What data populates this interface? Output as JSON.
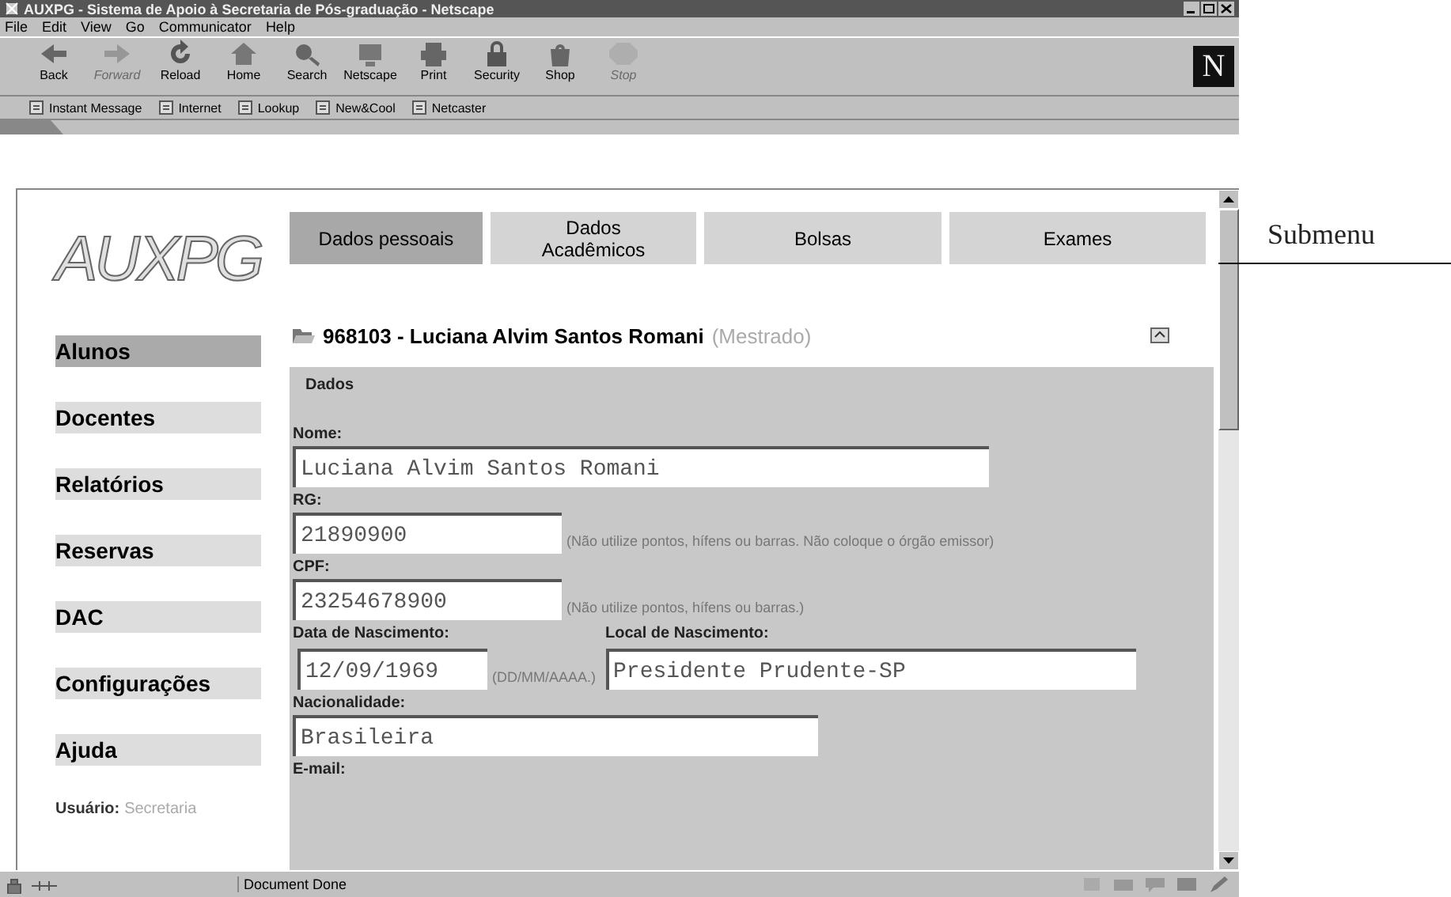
{
  "window": {
    "title": "AUXPG - Sistema de Apoio à Secretaria de Pós-graduação - Netscape"
  },
  "menu": [
    "File",
    "Edit",
    "View",
    "Go",
    "Communicator",
    "Help"
  ],
  "toolbar": [
    {
      "label": "Back",
      "disabled": false
    },
    {
      "label": "Forward",
      "disabled": true
    },
    {
      "label": "Reload",
      "disabled": false
    },
    {
      "label": "Home",
      "disabled": false
    },
    {
      "label": "Search",
      "disabled": false
    },
    {
      "label": "Netscape",
      "disabled": false
    },
    {
      "label": "Print",
      "disabled": false
    },
    {
      "label": "Security",
      "disabled": false
    },
    {
      "label": "Shop",
      "disabled": false
    },
    {
      "label": "Stop",
      "disabled": true
    }
  ],
  "logo_text": "N",
  "personal_toolbar": [
    "Instant Message",
    "Internet",
    "Lookup",
    "New&Cool",
    "Netcaster"
  ],
  "page": {
    "logo": "AUXPG",
    "sidebar": [
      {
        "label": "Alunos",
        "selected": true
      },
      {
        "label": "Docentes",
        "selected": false
      },
      {
        "label": "Relatórios",
        "selected": false
      },
      {
        "label": "Reservas",
        "selected": false
      },
      {
        "label": "DAC",
        "selected": false
      },
      {
        "label": "Configurações",
        "selected": false
      },
      {
        "label": "Ajuda",
        "selected": false
      }
    ],
    "user_label": "Usuário:",
    "user_value": "Secretaria",
    "tabs": [
      {
        "label": "Dados pessoais",
        "selected": true
      },
      {
        "label": "Dados Acadêmicos",
        "selected": false
      },
      {
        "label": "Bolsas",
        "selected": false
      },
      {
        "label": "Exames",
        "selected": false
      }
    ],
    "student": "968103 - Luciana Alvim Santos Romani",
    "program": "(Mestrado)",
    "form": {
      "legend": "Dados",
      "rows": [
        {
          "fields": [
            {
              "label": "Nome:",
              "value": "Luciana Alvim Santos Romani"
            }
          ]
        },
        {
          "fields": [
            {
              "label": "RG:",
              "value": "21890900",
              "hint": "(Não utilize pontos, hífens ou barras. Não coloque o órgão emissor)"
            }
          ]
        },
        {
          "fields": [
            {
              "label": "CPF:",
              "value": "23254678900",
              "hint": "(Não utilize pontos, hífens ou barras.)"
            }
          ]
        },
        {
          "fields": [
            {
              "label": "Data de Nascimento:",
              "value": "12/09/1969",
              "hint": "(DD/MM/AAAA.)"
            },
            {
              "label": "Local de Nascimento:",
              "value": "Presidente Prudente-SP"
            }
          ]
        },
        {
          "fields": [
            {
              "label": "Nacionalidade:",
              "value": "Brasileira"
            }
          ]
        },
        {
          "fields": [
            {
              "label": "E-mail:"
            }
          ]
        }
      ]
    }
  },
  "status_bar": {
    "text": "Document Done"
  },
  "annotation": "Submenu"
}
